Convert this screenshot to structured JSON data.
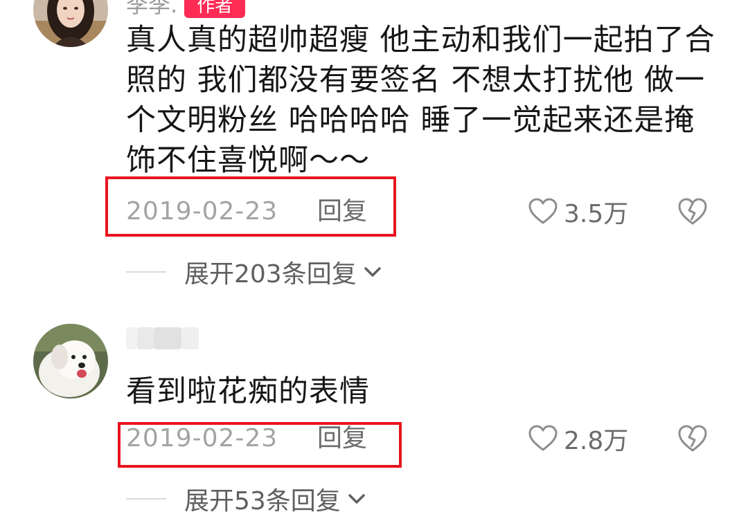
{
  "comments": [
    {
      "username": "李李.",
      "author_tag": "作者",
      "text": "真人真的超帅超瘦 他主动和我们一起拍了合照的 我们都没有要签名 不想太打扰他 做一个文明粉丝 哈哈哈哈 睡了一觉起来还是掩饰不住喜悦啊～～",
      "date": "2019-02-23",
      "reply_label": "回复",
      "likes": "3.5万",
      "expand_label": "展开203条回复"
    },
    {
      "username": "",
      "text": "看到啦花痴的表情",
      "date": "2019-02-23",
      "reply_label": "回复",
      "likes": "2.8万",
      "expand_label": "展开53条回复"
    }
  ],
  "colors": {
    "highlight": "#e8141f",
    "author_tag": "#fe2c55",
    "muted_text": "#a3a3a3",
    "body_text": "#161616"
  },
  "icons": [
    "heart-outline-icon",
    "broken-heart-icon",
    "chevron-down-icon"
  ]
}
